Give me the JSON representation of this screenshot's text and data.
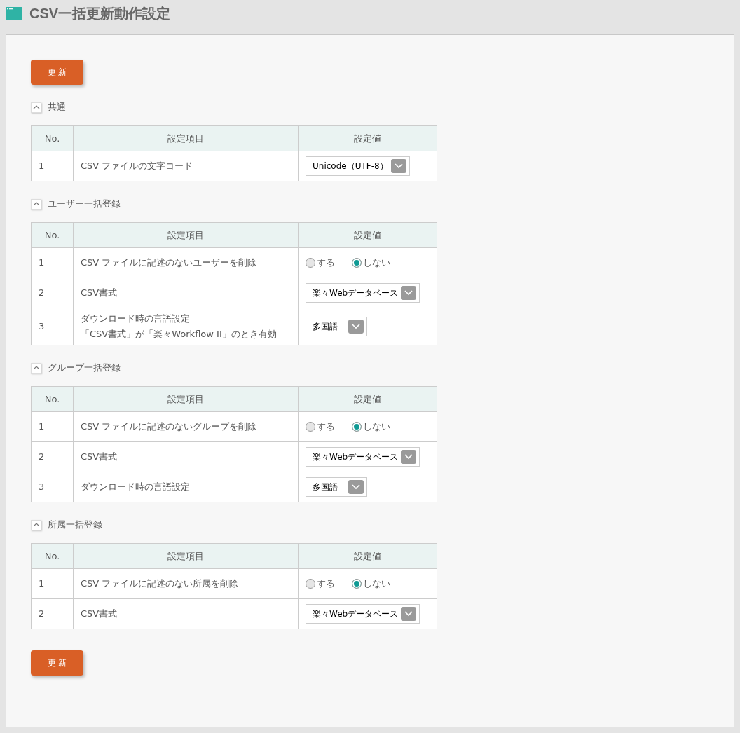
{
  "page_title": "CSV一括更新動作設定",
  "update_button_top": "更 新",
  "sections": [
    {
      "title": "共通",
      "expanded": true,
      "columns": [
        "No.",
        "設定項目",
        "設定値"
      ],
      "rows": [
        {
          "no": "1",
          "label": "CSV ファイルの文字コード",
          "kind": "select",
          "value": "Unicode（UTF-8）"
        }
      ]
    },
    {
      "title": "ユーザー一括登録",
      "expanded": true,
      "columns": [
        "No.",
        "設定項目",
        "設定値"
      ],
      "rows": [
        {
          "no": "1",
          "label": "CSV ファイルに記述のないユーザーを削除",
          "kind": "radio",
          "options": [
            {
              "label": "する",
              "selected": false
            },
            {
              "label": "しない",
              "selected": true
            }
          ]
        },
        {
          "no": "2",
          "label": "CSV書式",
          "kind": "select",
          "value": "楽々Webデータベース"
        },
        {
          "no": "3",
          "label": "ダウンロード時の言語設定",
          "note": "「CSV書式」が「楽々Workflow II」のとき有効",
          "kind": "select",
          "value": "多国語"
        }
      ]
    },
    {
      "title": "グループ一括登録",
      "expanded": true,
      "columns": [
        "No.",
        "設定項目",
        "設定値"
      ],
      "rows": [
        {
          "no": "1",
          "label": "CSV ファイルに記述のないグループを削除",
          "kind": "radio",
          "options": [
            {
              "label": "する",
              "selected": false
            },
            {
              "label": "しない",
              "selected": true
            }
          ]
        },
        {
          "no": "2",
          "label": "CSV書式",
          "kind": "select",
          "value": "楽々Webデータベース"
        },
        {
          "no": "3",
          "label": "ダウンロード時の言語設定",
          "kind": "select",
          "value": "多国語"
        }
      ]
    },
    {
      "title": "所属一括登録",
      "expanded": true,
      "columns": [
        "No.",
        "設定項目",
        "設定値"
      ],
      "rows": [
        {
          "no": "1",
          "label": "CSV ファイルに記述のない所属を削除",
          "kind": "radio",
          "options": [
            {
              "label": "する",
              "selected": false
            },
            {
              "label": "しない",
              "selected": true
            }
          ]
        },
        {
          "no": "2",
          "label": "CSV書式",
          "kind": "select",
          "value": "楽々Webデータベース"
        }
      ]
    }
  ],
  "update_button_bottom": "更 新"
}
